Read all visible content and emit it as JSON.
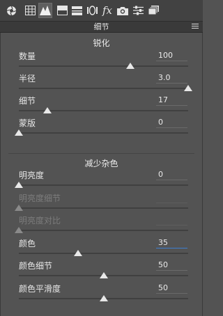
{
  "toolbar": {
    "tools": [
      {
        "icon": "aperture-icon",
        "active": false
      },
      {
        "icon": "grid-icon",
        "active": false
      },
      {
        "icon": "mountain-icon",
        "active": true
      },
      {
        "icon": "split-square-icon",
        "active": false
      },
      {
        "icon": "bars-icon",
        "active": false
      },
      {
        "icon": "lens-icon",
        "active": false
      },
      {
        "icon": "fx-icon",
        "active": false
      },
      {
        "icon": "camera-icon",
        "active": false
      },
      {
        "icon": "sliders-icon",
        "active": false
      },
      {
        "icon": "stack-icon",
        "active": false
      }
    ],
    "fx_text": "fx"
  },
  "panel": {
    "title": "细节"
  },
  "sharpening": {
    "title": "锐化",
    "rows": [
      {
        "label": "数量",
        "value": "100",
        "fraction": 0.66
      },
      {
        "label": "半径",
        "value": "3.0",
        "fraction": 1.0
      },
      {
        "label": "细节",
        "value": "17",
        "fraction": 0.17
      },
      {
        "label": "蒙版",
        "value": "0",
        "fraction": 0.0
      }
    ]
  },
  "noise": {
    "title": "减少杂色",
    "rows": [
      {
        "label": "明亮度",
        "value": "0",
        "fraction": 0.0,
        "disabled": false
      },
      {
        "label": "明亮度细节",
        "value": "",
        "fraction": 0.0,
        "disabled": true
      },
      {
        "label": "明亮度对比",
        "value": "",
        "fraction": 0.0,
        "disabled": true
      },
      {
        "label": "颜色",
        "value": "35",
        "fraction": 0.35,
        "disabled": false
      },
      {
        "label": "颜色细节",
        "value": "50",
        "fraction": 0.5,
        "disabled": false
      },
      {
        "label": "颜色平滑度",
        "value": "50",
        "fraction": 0.5,
        "disabled": false
      }
    ]
  }
}
